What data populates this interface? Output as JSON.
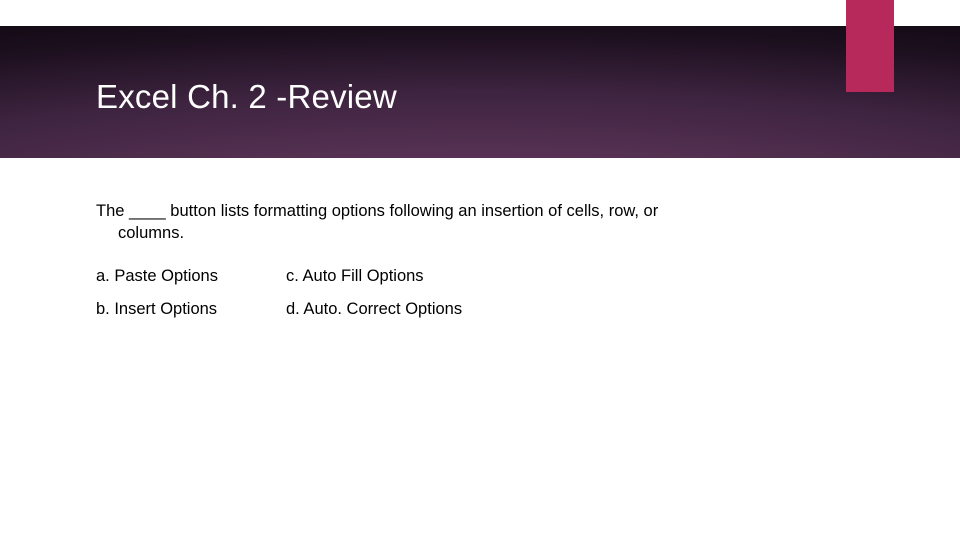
{
  "header": {
    "title": "Excel Ch. 2 -Review"
  },
  "question": {
    "line1": "The ____ button lists formatting options following an insertion of cells, row, or",
    "line2": "columns."
  },
  "options": {
    "a": "a. Paste Options",
    "b": "b. Insert Options",
    "c": "c. Auto Fill Options",
    "d": "d. Auto. Correct Options"
  }
}
